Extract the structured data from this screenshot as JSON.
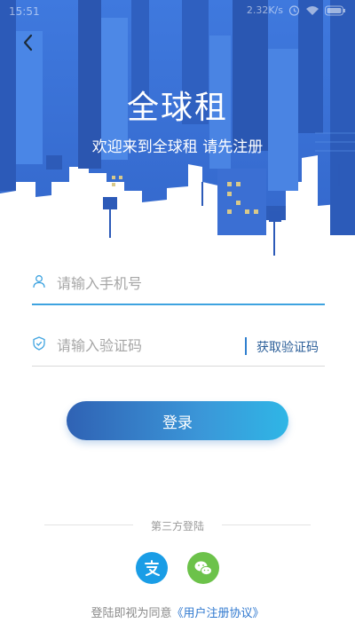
{
  "status_bar": {
    "time": "15:51",
    "speed": "2.32K/s",
    "icons": [
      "alarm-icon",
      "wifi-icon",
      "battery-icon"
    ]
  },
  "header": {
    "back_icon": "chevron-left-icon",
    "title": "全球租",
    "subtitle": "欢迎来到全球租 请先注册"
  },
  "form": {
    "phone": {
      "placeholder": "请输入手机号",
      "value": "",
      "icon": "user-icon"
    },
    "code": {
      "placeholder": "请输入验证码",
      "value": "",
      "icon": "shield-icon"
    },
    "get_code_label": "获取验证码",
    "login_label": "登录"
  },
  "third_party": {
    "label": "第三方登陆",
    "providers": [
      "alipay-icon",
      "wechat-icon"
    ]
  },
  "agreement": {
    "text": "登陆即视为同意",
    "link": "《用户注册协议》"
  },
  "colors": {
    "hero_blue": "#3a6fd8",
    "accent": "#3ea3e0",
    "link": "#2f78cf",
    "alipay": "#1a9de6",
    "wechat": "#6cc24a"
  }
}
